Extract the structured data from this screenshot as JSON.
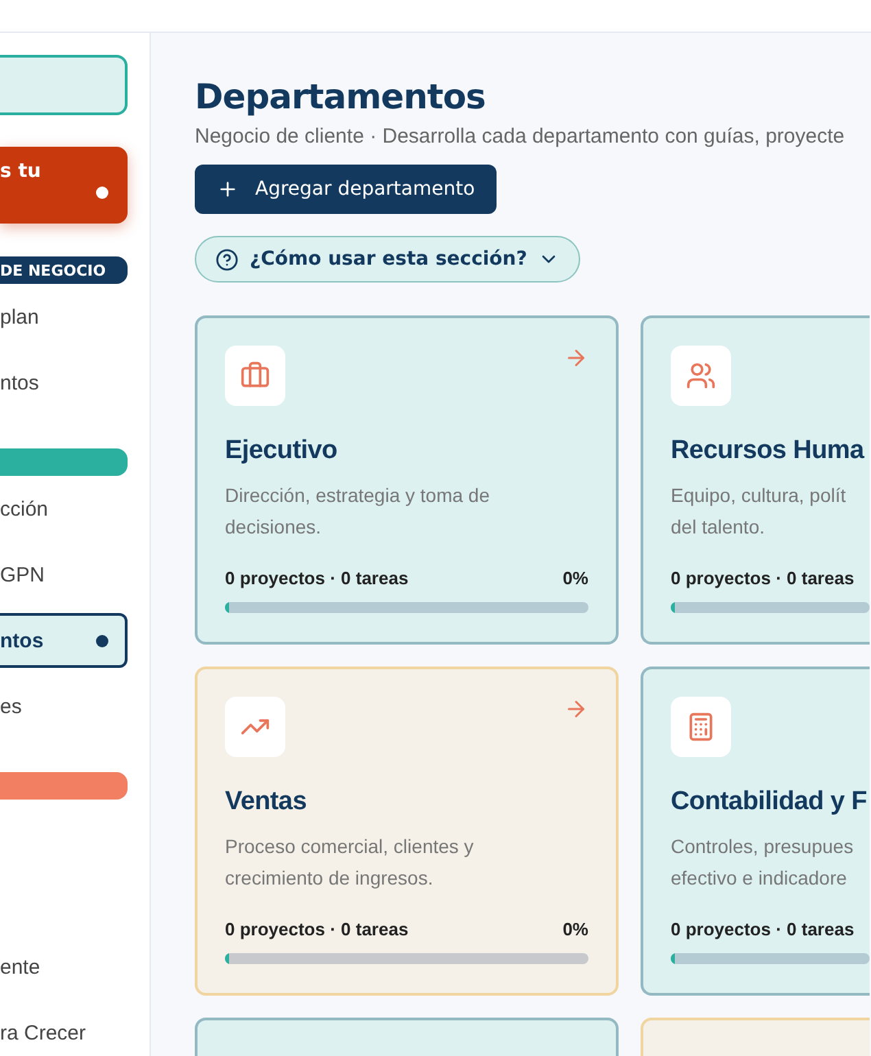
{
  "sidebar": {
    "items": [
      {
        "kind": "outline"
      },
      {
        "kind": "alert",
        "label": "s tu"
      },
      {
        "kind": "section",
        "color": "#133a5e",
        "label": "DE NEGOCIO"
      },
      {
        "kind": "link",
        "label": "plan",
        "selected": false
      },
      {
        "kind": "link",
        "label": "ntos",
        "selected": false
      },
      {
        "kind": "section",
        "color": "#2bb0a0"
      },
      {
        "kind": "link",
        "label": "cción",
        "selected": false
      },
      {
        "kind": "link",
        "label": "GPN",
        "selected": false
      },
      {
        "kind": "link",
        "label": "ntos",
        "selected": true
      },
      {
        "kind": "link",
        "label": "es",
        "selected": false
      },
      {
        "kind": "section",
        "color": "#f27f62"
      },
      {
        "kind": "link",
        "label": "ente",
        "selected": false
      },
      {
        "kind": "link",
        "label": "ra Crecer",
        "selected": false
      }
    ]
  },
  "header": {
    "title": "Departamentos",
    "subtitle": "Negocio de cliente · Desarrolla cada departamento con guías, proyecte",
    "add_button": "Agregar departamento",
    "help_button": "¿Cómo usar esta sección?"
  },
  "departments": [
    {
      "kind": "briefcase",
      "name": "Ejecutivo",
      "description": "Dirección, estrategia y toma de decisiones.",
      "color": "#dcf1f0",
      "arrow": true,
      "stats": "0 proyectos · 0 tareas",
      "percent": "0%",
      "level": 0
    },
    {
      "kind": "users",
      "name": "Recursos Huma",
      "description": "Equipo, cultura, polít del talento.",
      "color": "#dcf1f0",
      "arrow": false,
      "stats": "0 proyectos · 0 tareas",
      "level": 0
    },
    {
      "kind": "trend",
      "name": "Ventas",
      "description": "Proceso comercial, clientes y crecimiento de ingresos.",
      "color": "#f5f1e8",
      "arrow": true,
      "stats": "0 proyectos · 0 tareas",
      "percent": "0%",
      "level": 0
    },
    {
      "kind": "calculator",
      "name": "Contabilidad y F",
      "description": "Controles, presupues efectivo e indicadore",
      "color": "#dcf1f0",
      "arrow": false,
      "stats": "0 proyectos · 0 tareas",
      "level": 0
    },
    {
      "kind": "empty",
      "color": "#dcf1f0"
    },
    {
      "kind": "empty",
      "color": "#f5f1e8"
    }
  ]
}
